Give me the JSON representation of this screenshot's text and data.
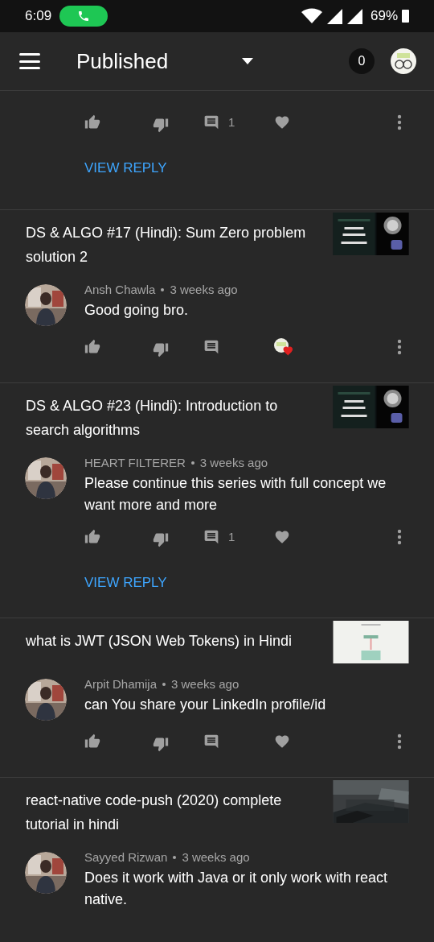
{
  "status_bar": {
    "time": "6:09",
    "battery": "69%"
  },
  "header": {
    "title": "Published",
    "notification_count": "0"
  },
  "comments": [
    {
      "kind": "partial",
      "reply_count": "1",
      "creator_hearted": false,
      "view_reply": "VIEW REPLY"
    },
    {
      "kind": "full",
      "video_title": "DS & ALGO #17 (Hindi): Sum Zero problem solution 2",
      "author": "Ansh Chawla",
      "time": "3 weeks ago",
      "text": "Good going bro.",
      "creator_hearted": true
    },
    {
      "kind": "full",
      "video_title": "DS & ALGO #23 (Hindi): Introduction to search algorithms",
      "author": "HEART FILTERER",
      "time": "3 weeks ago",
      "text": "Please continue this series with full concept we want more and more",
      "reply_count": "1",
      "creator_hearted": false,
      "view_reply": "VIEW REPLY"
    },
    {
      "kind": "full",
      "video_title": "what is JWT (JSON Web Tokens)  in Hindi",
      "author": "Arpit Dhamija",
      "time": "3 weeks ago",
      "text": "can You share your LinkedIn profile/id",
      "creator_hearted": false
    },
    {
      "kind": "full",
      "video_title": "react-native code-push (2020)  complete tutorial in hindi",
      "author": "Sayyed Rizwan",
      "time": "3 weeks ago",
      "text": "Does it work with Java or it only work with react native."
    }
  ]
}
